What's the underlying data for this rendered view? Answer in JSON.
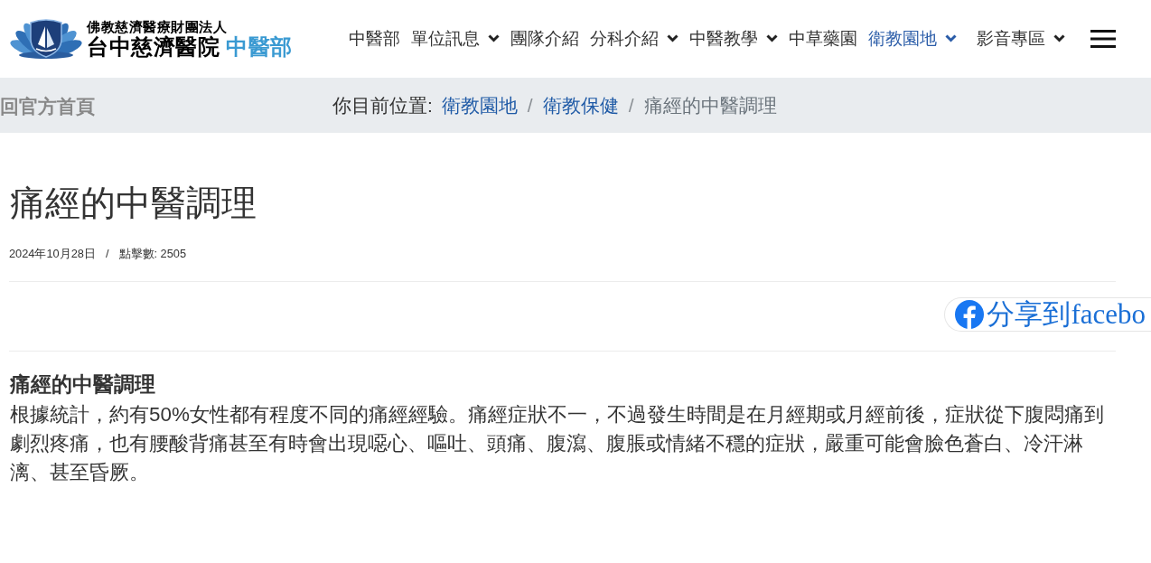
{
  "header": {
    "org_name": "佛教慈濟醫療財團法人",
    "hospital_name": "台中慈濟醫院",
    "department": "中醫部"
  },
  "nav": {
    "items": [
      {
        "label": "中醫部",
        "selected": false,
        "has_dropdown": false
      },
      {
        "label": "單位訊息",
        "selected": false,
        "has_dropdown": true
      },
      {
        "label": "團隊介紹",
        "selected": false,
        "has_dropdown": false
      },
      {
        "label": "分科介紹",
        "selected": false,
        "has_dropdown": true
      },
      {
        "label": "中醫教學",
        "selected": false,
        "has_dropdown": true
      },
      {
        "label": "中草藥園",
        "selected": false,
        "has_dropdown": false
      },
      {
        "label": "衛教園地",
        "selected": true,
        "has_dropdown": true
      },
      {
        "label": "影音專區",
        "selected": false,
        "has_dropdown": true
      }
    ]
  },
  "breadcrumb_bar": {
    "home_link": "回官方首頁",
    "prefix": "你目前位置:",
    "items": [
      {
        "kind": "link",
        "label": "衛教園地"
      },
      {
        "kind": "separator",
        "label": "/"
      },
      {
        "kind": "link",
        "label": "衛教保健"
      },
      {
        "kind": "separator",
        "label": "/"
      },
      {
        "kind": "current",
        "label": "痛經的中醫調理"
      }
    ]
  },
  "article": {
    "title": "痛經的中醫調理",
    "meta": [
      {
        "kind": "date",
        "text": "2024年10月28日"
      },
      {
        "kind": "separator",
        "text": "/"
      },
      {
        "kind": "hits",
        "text": "點擊數: 2505"
      }
    ],
    "share_button": "分享到facebo",
    "heading": "痛經的中醫調理",
    "paragraph": "根據統計，約有50%女性都有程度不同的痛經經驗。痛經症狀不一，不過發生時間是在月經期或月經前後，症狀從下腹悶痛到劇烈疼痛，也有腰酸背痛甚至有時會出現噁心、嘔吐、頭痛、腹瀉、腹脹或情緒不穩的症狀，嚴重可能會臉色蒼白、冷汗淋漓、甚至昏厥。"
  }
}
